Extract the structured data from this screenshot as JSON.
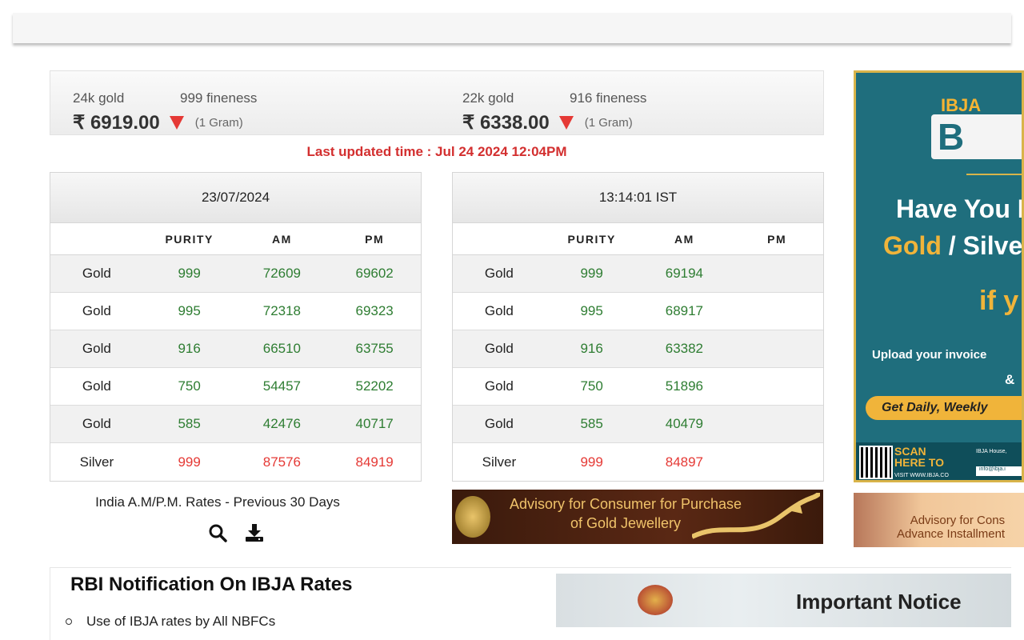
{
  "prices": [
    {
      "karat": "24k gold",
      "fineness": "999 fineness",
      "amount": "₹ 6919.00",
      "unit": "(1 Gram)",
      "trend": "down"
    },
    {
      "karat": "22k gold",
      "fineness": "916 fineness",
      "amount": "₹ 6338.00",
      "unit": "(1 Gram)",
      "trend": "down"
    }
  ],
  "last_updated": "Last updated time : Jul 24 2024 12:04PM",
  "tables": [
    {
      "header": "23/07/2024",
      "columns": [
        "",
        "PURITY",
        "AM",
        "PM"
      ],
      "rows": [
        [
          "Gold",
          "999",
          "72609",
          "69602"
        ],
        [
          "Gold",
          "995",
          "72318",
          "69323"
        ],
        [
          "Gold",
          "916",
          "66510",
          "63755"
        ],
        [
          "Gold",
          "750",
          "54457",
          "52202"
        ],
        [
          "Gold",
          "585",
          "42476",
          "40717"
        ],
        [
          "Silver",
          "999",
          "87576",
          "84919"
        ]
      ]
    },
    {
      "header": "13:14:01 IST",
      "columns": [
        "",
        "PURITY",
        "AM",
        "PM"
      ],
      "rows": [
        [
          "Gold",
          "999",
          "69194",
          ""
        ],
        [
          "Gold",
          "995",
          "68917",
          ""
        ],
        [
          "Gold",
          "916",
          "63382",
          ""
        ],
        [
          "Gold",
          "750",
          "51896",
          ""
        ],
        [
          "Gold",
          "585",
          "40479",
          ""
        ],
        [
          "Silver",
          "999",
          "84897",
          ""
        ]
      ]
    }
  ],
  "prev30_link": "India A.M/P.M. Rates - Previous 30 Days",
  "icons": {
    "search": "search-icon",
    "download": "download-icon"
  },
  "advisory_banner": {
    "line1": "Advisory for Consumer for Purchase",
    "line2": "of Gold Jewellery"
  },
  "ad_right": {
    "brand": "IBJA",
    "logo": "B",
    "headline1": "Have You P",
    "headline2_gold": "Gold",
    "headline2_rest": " / Silve",
    "headline3": "if y",
    "upload": "Upload your invoice",
    "amp": "&",
    "cta": "Get Daily, Weekly",
    "scan": "SCAN HERE TO",
    "visit": "VISIT WWW.IBJA.CO",
    "house": "IBJA House,",
    "email": "info@ibja.i"
  },
  "ad_small": {
    "line1": "Advisory for Cons",
    "line2": "Advance Installment"
  },
  "rbi": {
    "title": "RBI Notification On IBJA Rates",
    "items": [
      "Use of IBJA rates by All NBFCs"
    ]
  },
  "notice": {
    "text": "Important Notice"
  },
  "colors": {
    "green": "#2e7d32",
    "red": "#e53935",
    "alert": "#d32f2f",
    "teal": "#1f6e7d",
    "gold": "#f0b43a"
  }
}
